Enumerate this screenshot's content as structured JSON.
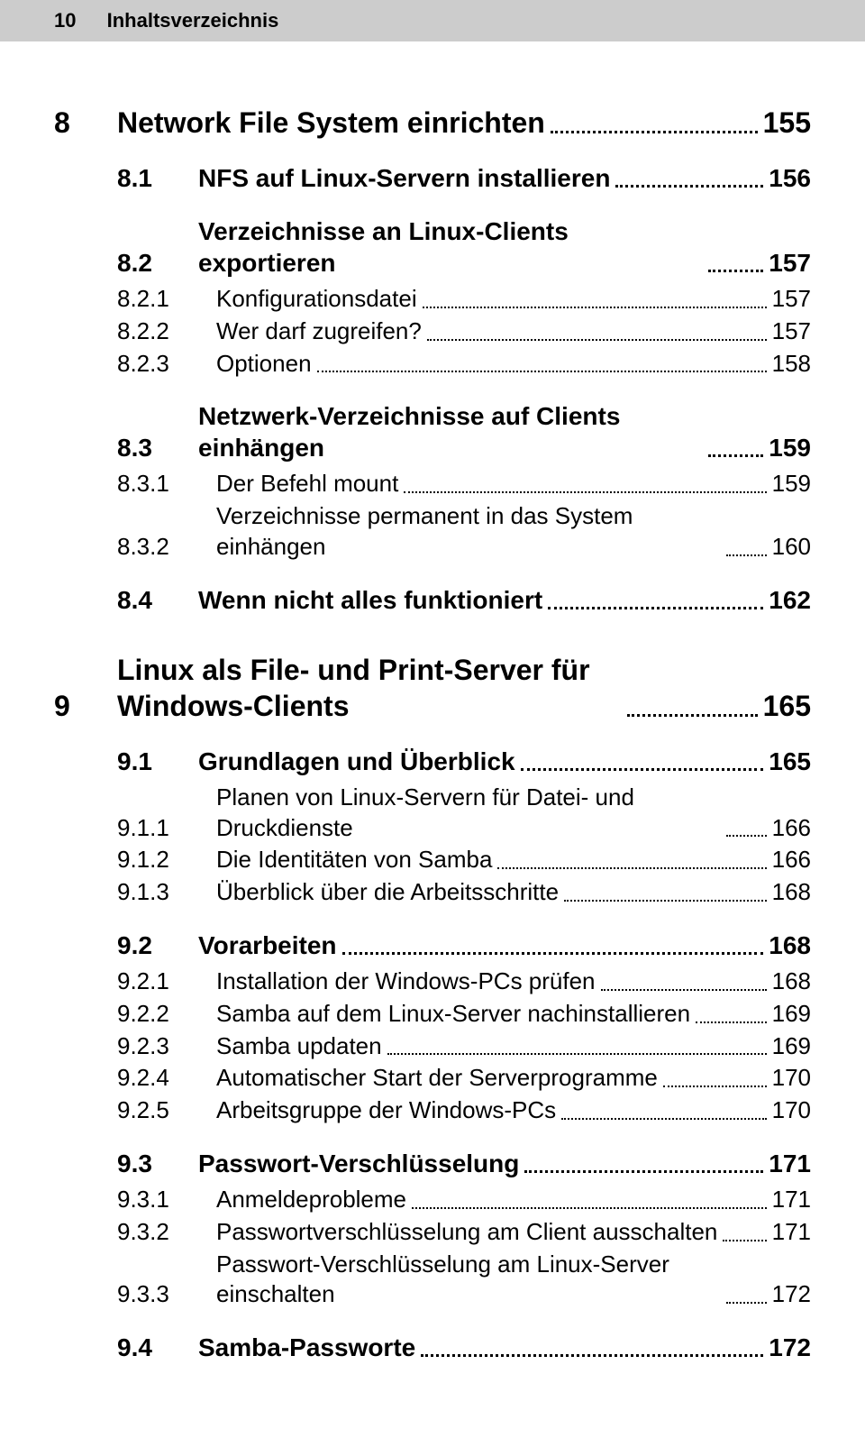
{
  "header": {
    "page_no": "10",
    "label": "Inhaltsverzeichnis"
  },
  "toc": {
    "c8": {
      "num": "8",
      "title": "Network File System einrichten",
      "page": "155",
      "s1": {
        "num": "8.1",
        "title": "NFS auf Linux-Servern installieren",
        "page": "156"
      },
      "s2": {
        "num": "8.2",
        "title": "Verzeichnisse an Linux-Clients exportieren",
        "page": "157",
        "i1": {
          "num": "8.2.1",
          "title": "Konfigurationsdatei",
          "page": "157"
        },
        "i2": {
          "num": "8.2.2",
          "title": "Wer darf zugreifen?",
          "page": "157"
        },
        "i3": {
          "num": "8.2.3",
          "title": "Optionen",
          "page": "158"
        }
      },
      "s3": {
        "num": "8.3",
        "title": "Netzwerk-Verzeichnisse auf Clients einhängen",
        "page": "159",
        "i1": {
          "num": "8.3.1",
          "title": "Der Befehl mount",
          "page": "159"
        },
        "i2": {
          "num": "8.3.2",
          "title": "Verzeichnisse permanent in das System einhängen",
          "page": "160"
        }
      },
      "s4": {
        "num": "8.4",
        "title": "Wenn nicht alles funktioniert",
        "page": "162"
      }
    },
    "c9": {
      "num": "9",
      "title": "Linux als File- und Print-Server für Windows-Clients",
      "page": "165",
      "s1": {
        "num": "9.1",
        "title": "Grundlagen und Überblick",
        "page": "165",
        "i1": {
          "num": "9.1.1",
          "title": "Planen von Linux-Servern für Datei- und Druckdienste",
          "page": "166"
        },
        "i2": {
          "num": "9.1.2",
          "title": "Die Identitäten von Samba",
          "page": "166"
        },
        "i3": {
          "num": "9.1.3",
          "title": "Überblick über die Arbeitsschritte",
          "page": "168"
        }
      },
      "s2": {
        "num": "9.2",
        "title": "Vorarbeiten",
        "page": "168",
        "i1": {
          "num": "9.2.1",
          "title": "Installation der Windows-PCs prüfen",
          "page": "168"
        },
        "i2": {
          "num": "9.2.2",
          "title": "Samba auf dem Linux-Server nachinstallieren",
          "page": "169"
        },
        "i3": {
          "num": "9.2.3",
          "title": "Samba updaten",
          "page": "169"
        },
        "i4": {
          "num": "9.2.4",
          "title": "Automatischer Start der Serverprogramme",
          "page": "170"
        },
        "i5": {
          "num": "9.2.5",
          "title": "Arbeitsgruppe der Windows-PCs",
          "page": "170"
        }
      },
      "s3": {
        "num": "9.3",
        "title": "Passwort-Verschlüsselung",
        "page": "171",
        "i1": {
          "num": "9.3.1",
          "title": "Anmeldeprobleme",
          "page": "171"
        },
        "i2": {
          "num": "9.3.2",
          "title": "Passwortverschlüsselung am Client ausschalten",
          "page": "171"
        },
        "i3": {
          "num": "9.3.3",
          "title": "Passwort-Verschlüsselung am Linux-Server einschalten",
          "page": "172"
        }
      },
      "s4": {
        "num": "9.4",
        "title": "Samba-Passworte",
        "page": "172"
      }
    }
  }
}
